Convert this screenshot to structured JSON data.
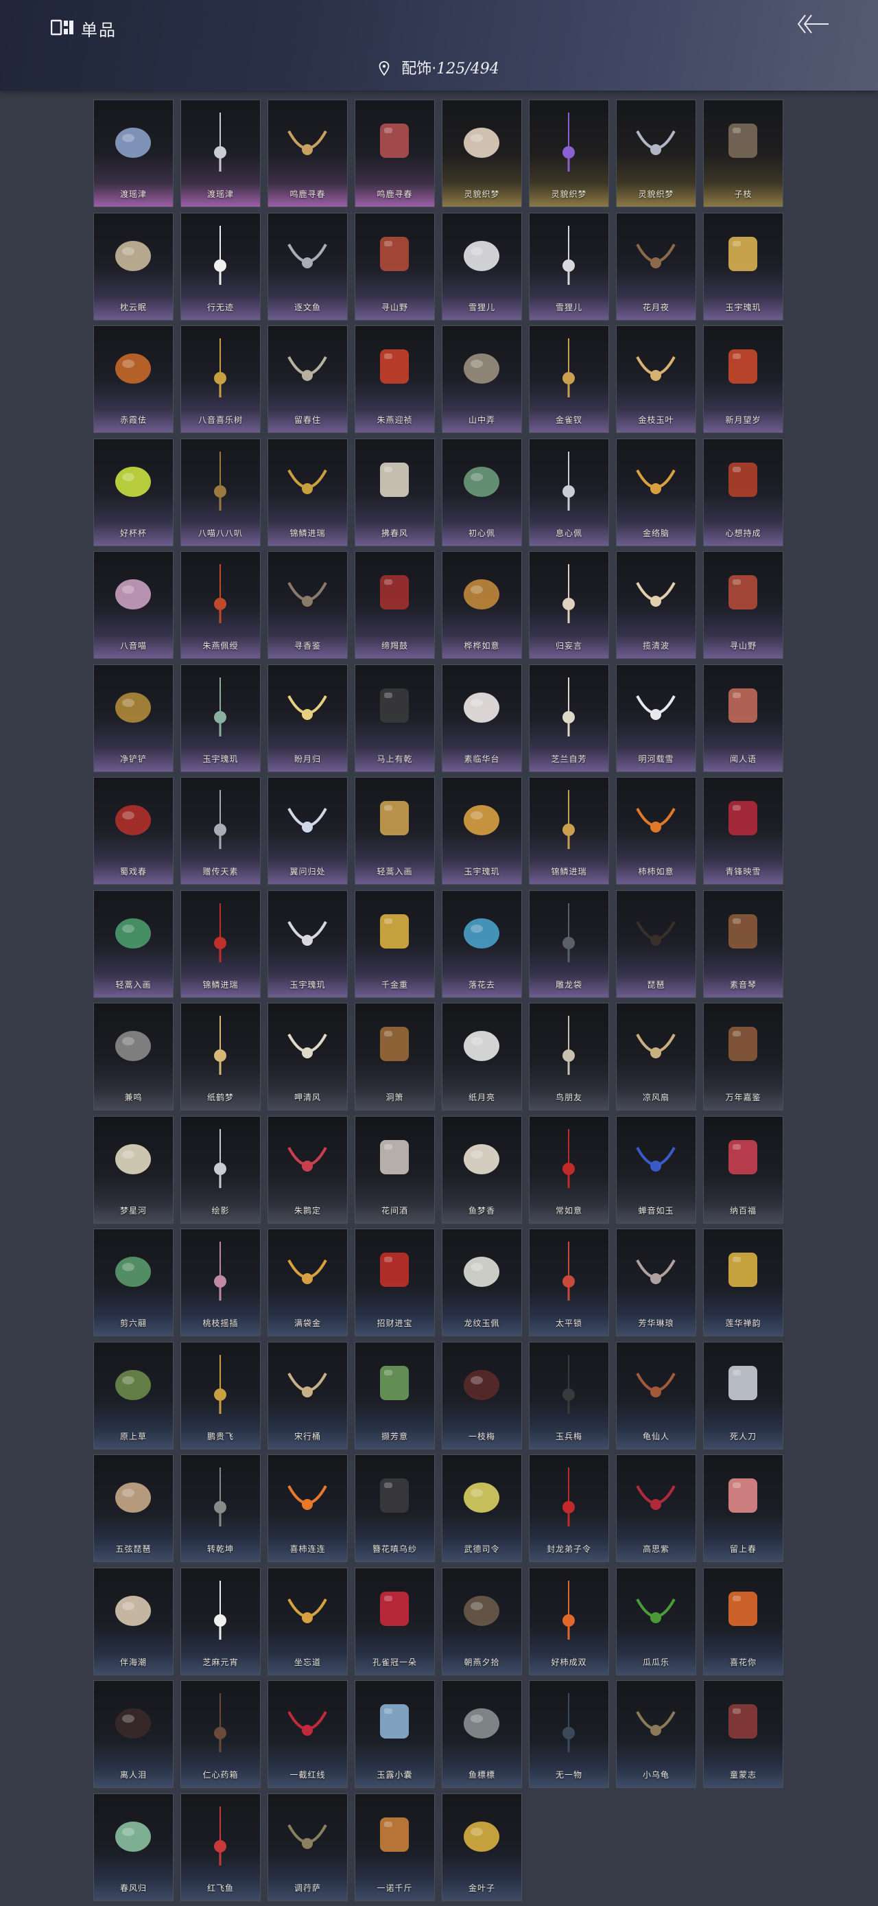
{
  "header": {
    "title": "单品",
    "category_label": "配饰·",
    "count": "125/494",
    "icons": {
      "app": "collection-icon",
      "back": "back-arrow-icon",
      "location": "location-pin-icon"
    }
  },
  "items": [
    {
      "label": "渡瑶津",
      "tier": "r-pink",
      "color": "#8aa0c8",
      "icon": "hairpin-icon"
    },
    {
      "label": "渡瑶津",
      "tier": "r-pink",
      "color": "#c9ccd4",
      "icon": "hair-ornament-icon"
    },
    {
      "label": "鸣鹿寻春",
      "tier": "r-pink",
      "color": "#c8a060",
      "icon": "necklace-icon"
    },
    {
      "label": "鸣鹿寻春",
      "tier": "r-pink",
      "color": "#b05050",
      "icon": "earrings-icon"
    },
    {
      "label": "灵貌织梦",
      "tier": "r-gold",
      "color": "#e2d4c0",
      "icon": "claw-glove-icon"
    },
    {
      "label": "灵貌织梦",
      "tier": "r-gold",
      "color": "#8a60d0",
      "icon": "ornament-pair-icon"
    },
    {
      "label": "灵貌织梦",
      "tier": "r-gold",
      "color": "#b0b6c4",
      "icon": "headpiece-icon"
    },
    {
      "label": "子枝",
      "tier": "r-gold",
      "color": "#7a6a5a",
      "icon": "tassel-icon"
    },
    {
      "label": "枕云眠",
      "tier": "r-purple",
      "color": "#c8b89a",
      "icon": "mask-icon"
    },
    {
      "label": "行无迹",
      "tier": "r-purple",
      "color": "#f0f0f0",
      "icon": "fur-ornament-icon"
    },
    {
      "label": "逐文鱼",
      "tier": "r-purple",
      "color": "#a8acb4",
      "icon": "bracelet-icon"
    },
    {
      "label": "寻山野",
      "tier": "r-purple",
      "color": "#b04a3a",
      "icon": "abacus-icon"
    },
    {
      "label": "雪狸儿",
      "tier": "r-purple",
      "color": "#e4e4e8",
      "icon": "tail-icon"
    },
    {
      "label": "雪狸儿",
      "tier": "r-purple",
      "color": "#d8d8dc",
      "icon": "ears-icon"
    },
    {
      "label": "花月夜",
      "tier": "r-purple",
      "color": "#8a6a4a",
      "icon": "pipa-icon"
    },
    {
      "label": "玉宇瑰玑",
      "tier": "r-purple",
      "color": "#d8b050",
      "icon": "crescent-icon"
    },
    {
      "label": "赤霞佉",
      "tier": "r-purple",
      "color": "#c8682a",
      "icon": "ribbon-icon"
    },
    {
      "label": "八音喜乐树",
      "tier": "r-purple",
      "color": "#c8a040",
      "icon": "tree-ornament-icon"
    },
    {
      "label": "留春住",
      "tier": "r-purple",
      "color": "#b8b0a0",
      "icon": "hairpin-icon"
    },
    {
      "label": "朱燕迎祯",
      "tier": "r-purple",
      "color": "#c8402a",
      "icon": "bird-pair-icon"
    },
    {
      "label": "山中弄",
      "tier": "r-purple",
      "color": "#9a9080",
      "icon": "lantern-icon"
    },
    {
      "label": "金雀钗",
      "tier": "r-purple",
      "color": "#c8a050",
      "icon": "hairpin-icon"
    },
    {
      "label": "金枝玉叶",
      "tier": "r-purple",
      "color": "#d8b070",
      "icon": "hairpin-icon"
    },
    {
      "label": "新月望岁",
      "tier": "r-purple",
      "color": "#c8482a",
      "icon": "dragon-icon"
    },
    {
      "label": "好杯杯",
      "tier": "r-purple",
      "color": "#c8e040",
      "icon": "cup-icon"
    },
    {
      "label": "八喵八八叭",
      "tier": "r-purple",
      "color": "#9a7a40",
      "icon": "cat-figure-icon"
    },
    {
      "label": "锦鳞进瑞",
      "tier": "r-purple",
      "color": "#c8a040",
      "icon": "necklace-icon"
    },
    {
      "label": "拂春风",
      "tier": "r-purple",
      "color": "#d8d0c0",
      "icon": "scarf-icon"
    },
    {
      "label": "初心佩",
      "tier": "r-purple",
      "color": "#6a9a7a",
      "icon": "pendant-icon"
    },
    {
      "label": "息心佩",
      "tier": "r-purple",
      "color": "#c8ccd4",
      "icon": "pendant-icon"
    },
    {
      "label": "金络脑",
      "tier": "r-purple",
      "color": "#d8a040",
      "icon": "bird-icon"
    },
    {
      "label": "心想持成",
      "tier": "r-purple",
      "color": "#b0402a",
      "icon": "gourd-icon"
    },
    {
      "label": "八音喵",
      "tier": "r-purple",
      "color": "#c8a0c0",
      "icon": "charm-icon"
    },
    {
      "label": "朱燕佩绶",
      "tier": "r-purple",
      "color": "#c04a2a",
      "icon": "tassel-icon"
    },
    {
      "label": "寻香鉴",
      "tier": "r-purple",
      "color": "#8a7a6a",
      "icon": "box-icon"
    },
    {
      "label": "缔羯鼓",
      "tier": "r-purple",
      "color": "#a03030",
      "icon": "drum-icon"
    },
    {
      "label": "桦桦如意",
      "tier": "r-purple",
      "color": "#c0883a",
      "icon": "pendant-icon"
    },
    {
      "label": "归妄言",
      "tier": "r-purple",
      "color": "#e0d0c0",
      "icon": "feather-icon"
    },
    {
      "label": "揽清波",
      "tier": "r-purple",
      "color": "#e0d0b0",
      "icon": "duck-icon"
    },
    {
      "label": "寻山野",
      "tier": "r-purple",
      "color": "#b04a3a",
      "icon": "necklace-icon"
    },
    {
      "label": "净铲铲",
      "tier": "r-purple",
      "color": "#b08a3a",
      "icon": "shovel-icon"
    },
    {
      "label": "玉宇瑰玑",
      "tier": "r-purple",
      "color": "#8ab0a0",
      "icon": "sword-icon"
    },
    {
      "label": "盼月归",
      "tier": "r-purple",
      "color": "#e8d080",
      "icon": "moon-icon"
    },
    {
      "label": "马上有乾",
      "tier": "r-purple",
      "color": "#3a3a3c",
      "icon": "ears-icon"
    },
    {
      "label": "素临华台",
      "tier": "r-purple",
      "color": "#f0e8e8",
      "icon": "fur-ornament-icon"
    },
    {
      "label": "芝兰自芳",
      "tier": "r-purple",
      "color": "#e0d8c8",
      "icon": "flower-icon"
    },
    {
      "label": "明河载雪",
      "tier": "r-purple",
      "color": "#e8e8ec",
      "icon": "necklace-icon"
    },
    {
      "label": "闻人语",
      "tier": "r-purple",
      "color": "#c06a5a",
      "icon": "ears-icon"
    },
    {
      "label": "蜀戏春",
      "tier": "r-purple",
      "color": "#b0302a",
      "icon": "crown-icon"
    },
    {
      "label": "赠传天素",
      "tier": "r-purple",
      "color": "#a8acb4",
      "icon": "headpiece-icon"
    },
    {
      "label": "翼问归处",
      "tier": "r-purple",
      "color": "#d0d8e8",
      "icon": "hairpin-icon"
    },
    {
      "label": "轻蒿入画",
      "tier": "r-purple",
      "color": "#c8a050",
      "icon": "hairpin-icon"
    },
    {
      "label": "玉宇瑰玑",
      "tier": "r-purple",
      "color": "#d8a040",
      "icon": "pendant-icon"
    },
    {
      "label": "锦鳞进瑞",
      "tier": "r-purple",
      "color": "#c8a050",
      "icon": "hairpin-icon"
    },
    {
      "label": "柿柿如意",
      "tier": "r-purple",
      "color": "#e0782a",
      "icon": "persimmon-icon"
    },
    {
      "label": "青锋映雪",
      "tier": "r-purple",
      "color": "#b02a3a",
      "icon": "tassel-icon"
    },
    {
      "label": "轻蒿入画",
      "tier": "r-purple",
      "color": "#4a9a6a",
      "icon": "figure-icon"
    },
    {
      "label": "锦鳞进瑞",
      "tier": "r-purple",
      "color": "#c0302a",
      "icon": "tassel-icon"
    },
    {
      "label": "玉宇瑰玑",
      "tier": "r-purple",
      "color": "#d8d8dc",
      "icon": "pendant-icon"
    },
    {
      "label": "千金重",
      "tier": "r-purple",
      "color": "#d8b040",
      "icon": "gold-ingot-icon"
    },
    {
      "label": "落花去",
      "tier": "r-purple",
      "color": "#4aa0c8",
      "icon": "flower-icon"
    },
    {
      "label": "雕龙袋",
      "tier": "r-purple",
      "color": "#5a6068",
      "icon": "bag-icon"
    },
    {
      "label": "琵琶",
      "tier": "r-purple",
      "color": "#3a302a",
      "icon": "pipa-icon"
    },
    {
      "label": "素音琴",
      "tier": "r-purple",
      "color": "#8a5a3a",
      "icon": "zither-icon"
    },
    {
      "label": "兼鸣",
      "tier": "r-slate",
      "color": "#8a8a8a",
      "icon": "shield-icon"
    },
    {
      "label": "纸鹤梦",
      "tier": "r-slate",
      "color": "#d8b878",
      "icon": "paper-crane-icon"
    },
    {
      "label": "呷清风",
      "tier": "r-slate",
      "color": "#e0d8c8",
      "icon": "fan-icon"
    },
    {
      "label": "洞箫",
      "tier": "r-slate",
      "color": "#9a6a3a",
      "icon": "flute-icon"
    },
    {
      "label": "纸月亮",
      "tier": "r-slate",
      "color": "#e8e8e8",
      "icon": "lantern-icon"
    },
    {
      "label": "鸟朋友",
      "tier": "r-slate",
      "color": "#c8c0b0",
      "icon": "bird-icon"
    },
    {
      "label": "凉风扇",
      "tier": "r-slate",
      "color": "#c8b080",
      "icon": "fan-icon"
    },
    {
      "label": "万年嘉鉴",
      "tier": "r-slate",
      "color": "#8a5a3a",
      "icon": "teapot-icon"
    },
    {
      "label": "梦星河",
      "tier": "r-slate",
      "color": "#e0d8c0",
      "icon": "boat-icon"
    },
    {
      "label": "绘影",
      "tier": "r-slate",
      "color": "#c8ccd4",
      "icon": "scroll-icon"
    },
    {
      "label": "朱鹮定",
      "tier": "r-slate",
      "color": "#c84050",
      "icon": "knot-icon"
    },
    {
      "label": "花间酒",
      "tier": "r-slate",
      "color": "#c8c0b8",
      "icon": "bottle-icon"
    },
    {
      "label": "鱼梦香",
      "tier": "r-slate",
      "color": "#e8e0d0",
      "icon": "sachet-icon"
    },
    {
      "label": "常如意",
      "tier": "r-slate",
      "color": "#c02a2a",
      "icon": "tassel-icon"
    },
    {
      "label": "蝉音如玉",
      "tier": "r-slate",
      "color": "#3a5ac8",
      "icon": "tassel-icon"
    },
    {
      "label": "纳百福",
      "tier": "r-slate",
      "color": "#c84050",
      "icon": "bag-icon"
    },
    {
      "label": "剪六翮",
      "tier": "r-blue",
      "color": "#5a9a6a",
      "icon": "dagger-icon"
    },
    {
      "label": "桃枝摇插",
      "tier": "r-blue",
      "color": "#c08aa0",
      "icon": "hairpin-icon"
    },
    {
      "label": "满袋金",
      "tier": "r-blue",
      "color": "#d8a040",
      "icon": "bag-icon"
    },
    {
      "label": "招财进宝",
      "tier": "r-blue",
      "color": "#c0302a",
      "icon": "pendant-icon"
    },
    {
      "label": "龙纹玉佩",
      "tier": "r-blue",
      "color": "#e0e0d8",
      "icon": "jade-icon"
    },
    {
      "label": "太平锁",
      "tier": "r-blue",
      "color": "#c84a3a",
      "icon": "tassel-icon"
    },
    {
      "label": "芳华琳琅",
      "tier": "r-blue",
      "color": "#b0a0a0",
      "icon": "tassel-icon"
    },
    {
      "label": "莲华禅韵",
      "tier": "r-blue",
      "color": "#d8b040",
      "icon": "lotus-icon"
    },
    {
      "label": "原上草",
      "tier": "r-blue",
      "color": "#6a8a4a",
      "icon": "vase-icon"
    },
    {
      "label": "鹏贵飞",
      "tier": "r-blue",
      "color": "#c8a040",
      "icon": "hairpin-icon"
    },
    {
      "label": "宋行桶",
      "tier": "r-blue",
      "color": "#c8b088",
      "icon": "barrel-icon"
    },
    {
      "label": "撷芳意",
      "tier": "r-blue",
      "color": "#6a9a5a",
      "icon": "wreath-icon"
    },
    {
      "label": "一枝梅",
      "tier": "r-blue",
      "color": "#5a2a2a",
      "icon": "branch-icon"
    },
    {
      "label": "玉兵梅",
      "tier": "r-blue",
      "color": "#3a3a3c",
      "icon": "quiver-icon"
    },
    {
      "label": "龟仙人",
      "tier": "r-blue",
      "color": "#a05a3a",
      "icon": "shell-icon"
    },
    {
      "label": "死人刀",
      "tier": "r-blue",
      "color": "#c8ccd4",
      "icon": "blade-icon"
    },
    {
      "label": "五弦琵琶",
      "tier": "r-blue",
      "color": "#c8a888",
      "icon": "pipa-icon"
    },
    {
      "label": "转乾坤",
      "tier": "r-blue",
      "color": "#8a8a8a",
      "icon": "pendant-icon"
    },
    {
      "label": "喜柿连连",
      "tier": "r-blue",
      "color": "#e8782a",
      "icon": "persimmon-icon"
    },
    {
      "label": "簪花嗔乌纱",
      "tier": "r-blue",
      "color": "#3a3a3e",
      "icon": "hat-icon"
    },
    {
      "label": "武德司令",
      "tier": "r-blue",
      "color": "#d8d060",
      "icon": "token-icon"
    },
    {
      "label": "封龙弟子令",
      "tier": "r-blue",
      "color": "#c02a2a",
      "icon": "token-icon"
    },
    {
      "label": "高思紫",
      "tier": "r-blue",
      "color": "#b02a3a",
      "icon": "necklace-icon"
    },
    {
      "label": "留上春",
      "tier": "r-blue",
      "color": "#e08a8a",
      "icon": "flower-icon"
    },
    {
      "label": "伴海潮",
      "tier": "r-blue",
      "color": "#d8c8b0",
      "icon": "starfish-icon"
    },
    {
      "label": "芝麻元宵",
      "tier": "r-blue",
      "color": "#f0f0f0",
      "icon": "panda-icon"
    },
    {
      "label": "坐忘道",
      "tier": "r-blue",
      "color": "#d8a040",
      "icon": "ornament-icon"
    },
    {
      "label": "孔雀冠一朵",
      "tier": "r-blue",
      "color": "#c82a3a",
      "icon": "flower-icon"
    },
    {
      "label": "朝燕夕拾",
      "tier": "r-blue",
      "color": "#6a5a4a",
      "icon": "brush-icon"
    },
    {
      "label": "好柿成双",
      "tier": "r-blue",
      "color": "#e0682a",
      "icon": "hairpin-icon"
    },
    {
      "label": "瓜瓜乐",
      "tier": "r-blue",
      "color": "#4a9a3a",
      "icon": "cucumber-icon"
    },
    {
      "label": "喜花你",
      "tier": "r-blue",
      "color": "#e0682a",
      "icon": "flower-icon"
    },
    {
      "label": "离人泪",
      "tier": "r-blue",
      "color": "#3a2a2a",
      "icon": "jar-icon"
    },
    {
      "label": "仁心药箱",
      "tier": "r-blue",
      "color": "#6a4a3a",
      "icon": "chest-icon"
    },
    {
      "label": "一截红线",
      "tier": "r-blue",
      "color": "#c02a3a",
      "icon": "bracelet-icon"
    },
    {
      "label": "玉露小囊",
      "tier": "r-blue",
      "color": "#8ab0d0",
      "icon": "sachet-icon"
    },
    {
      "label": "鱼標標",
      "tier": "r-blue",
      "color": "#8a9090",
      "icon": "fish-icon"
    },
    {
      "label": "无一物",
      "tier": "r-blue",
      "color": "#3a4a5a",
      "icon": "bag-icon"
    },
    {
      "label": "小乌龟",
      "tier": "r-blue",
      "color": "#8a7a5a",
      "icon": "turtle-icon"
    },
    {
      "label": "童蒙志",
      "tier": "r-blue",
      "color": "#8a3a3a",
      "icon": "crossed-sticks-icon"
    },
    {
      "label": "春风归",
      "tier": "r-blue",
      "color": "#8ac0a0",
      "icon": "kite-icon"
    },
    {
      "label": "红飞鱼",
      "tier": "r-blue",
      "color": "#c83a3a",
      "icon": "kite-icon"
    },
    {
      "label": "调荇萨",
      "tier": "r-blue",
      "color": "#8a8060",
      "icon": "feathers-icon"
    },
    {
      "label": "一诺千斤",
      "tier": "r-blue",
      "color": "#c8803a",
      "icon": "roast-chicken-icon"
    },
    {
      "label": "金叶子",
      "tier": "r-blue",
      "color": "#d8b040",
      "icon": "gold-leaf-icon"
    }
  ]
}
